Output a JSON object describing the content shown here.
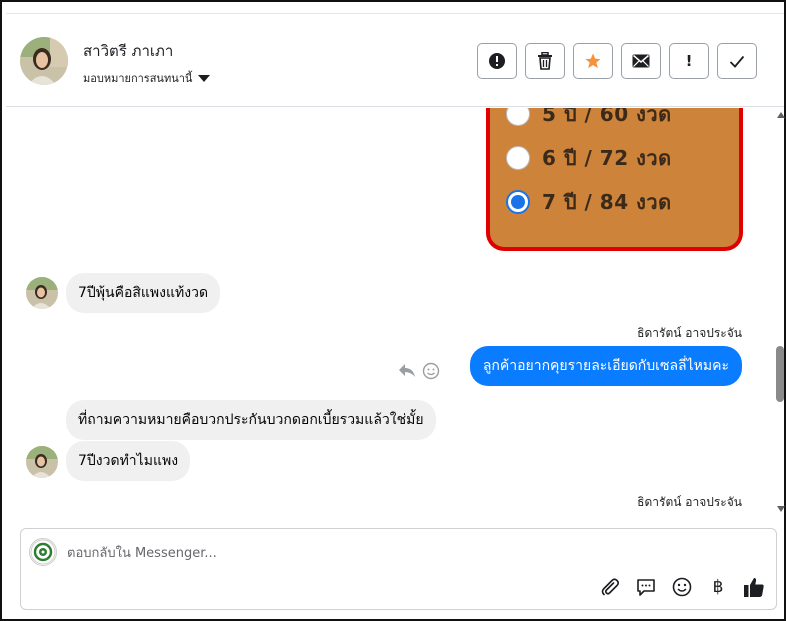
{
  "header": {
    "contact_name": "สาวิตรี ภาเภา",
    "assign_label": "มอบหมายการสนทนานี้"
  },
  "actions": [
    {
      "name": "mark-spam-button",
      "icon": "alert-circle-icon",
      "glyph": "!"
    },
    {
      "name": "delete-button",
      "icon": "trash-icon"
    },
    {
      "name": "star-button",
      "icon": "star-icon",
      "color": "#f7923a"
    },
    {
      "name": "mark-unread-button",
      "icon": "envelope-icon"
    },
    {
      "name": "follow-up-button",
      "icon": "exclamation-icon",
      "glyph": "!"
    },
    {
      "name": "mark-done-button",
      "icon": "checkmark-icon"
    }
  ],
  "survey": {
    "options": [
      {
        "label": "5 ปี / 60 งวด",
        "selected": false
      },
      {
        "label": "6 ปี / 72 งวด",
        "selected": false
      },
      {
        "label": "7 ปี / 84 งวด",
        "selected": true
      }
    ],
    "background": "#cd833a",
    "border": "#e00000"
  },
  "messages": {
    "m1": "7ปีพุ้นคือสิแพงแท้งวด",
    "sender1": "ธิดารัตน์ อาจประจัน",
    "m2": "ลูกค้าอยากคุยรายละเอียดกับเซลลี่ไหมคะ",
    "m3": "ที่ถามความหมายคือบวกประกันบวกดอกเบี้ยรวมแล้วใช่มั้ย",
    "m4": "7ปีงวดทำไมแพง",
    "sender2": "ธิดารัตน์ อาจประจัน"
  },
  "composer": {
    "placeholder": "ตอบกลับใน Messenger...",
    "currency_glyph": "฿"
  },
  "colors": {
    "accent": "#0a7cff",
    "incoming_bubble": "#f0f0f0"
  }
}
